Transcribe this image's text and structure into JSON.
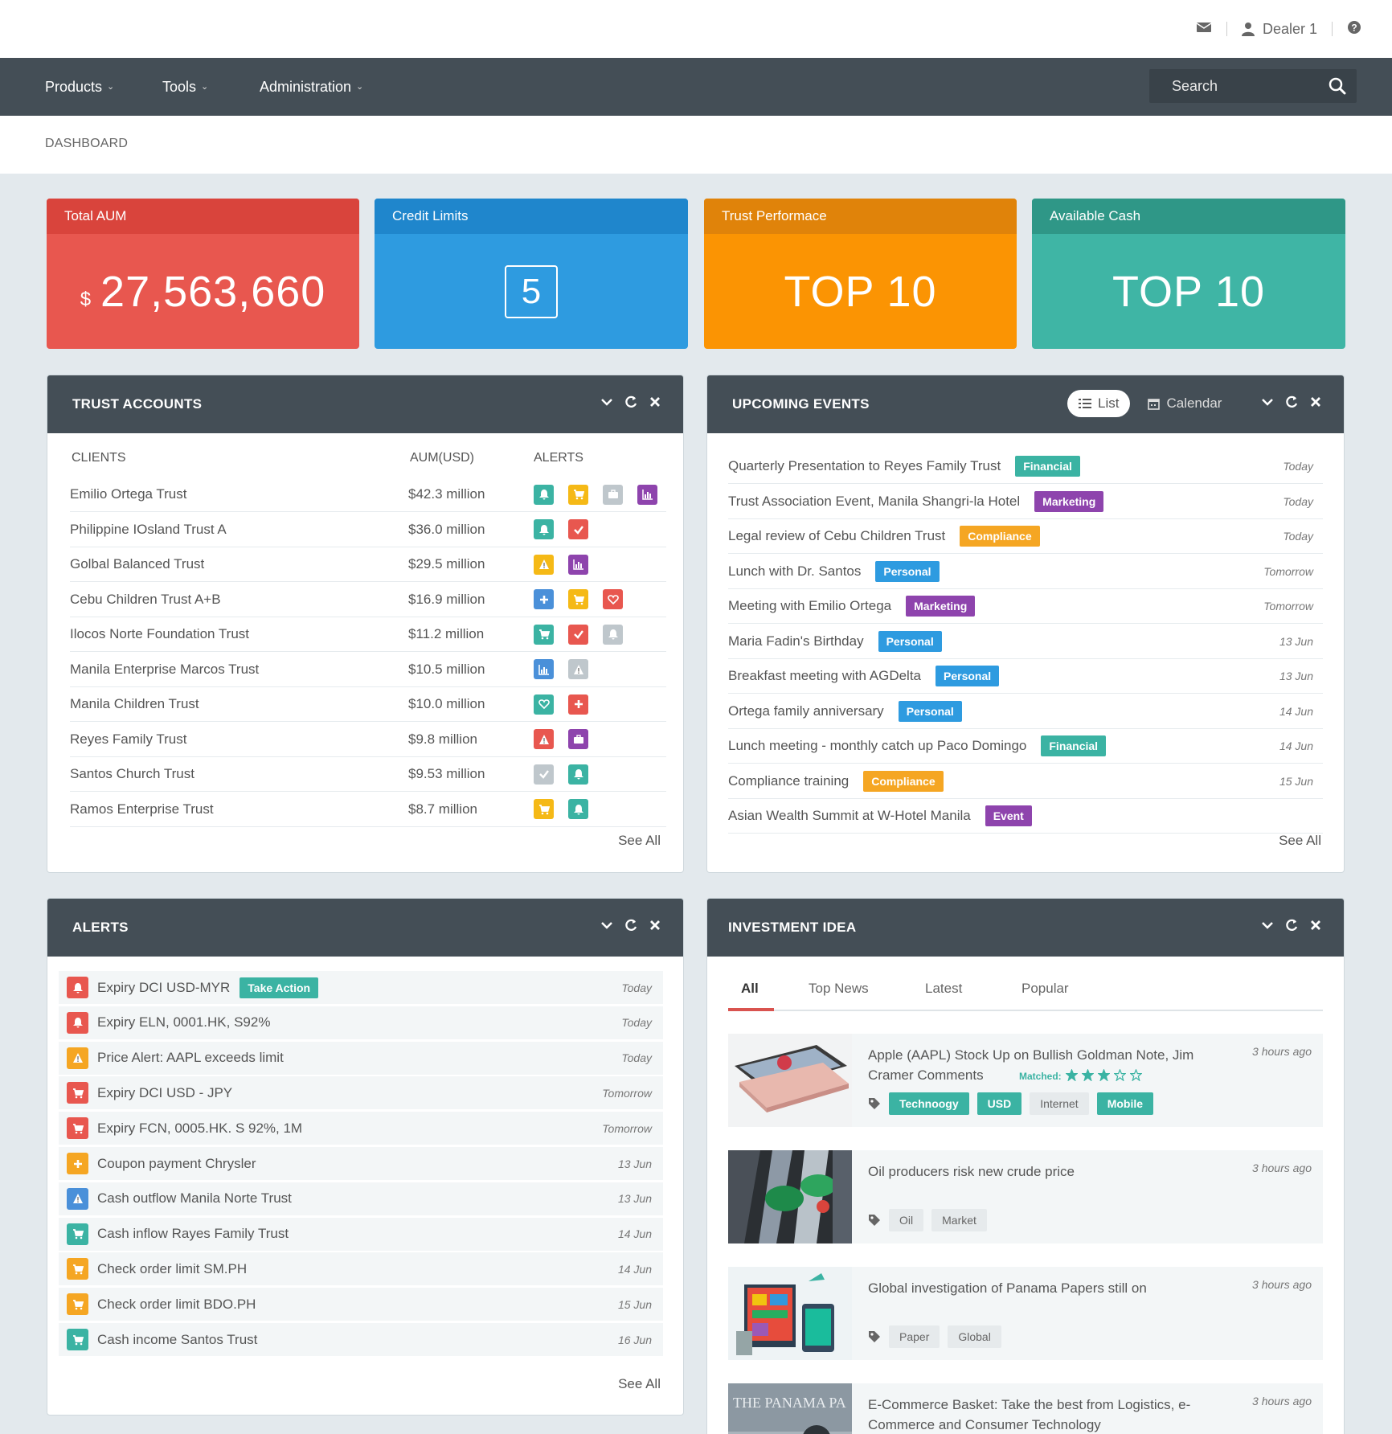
{
  "topbar": {
    "user": "Dealer 1"
  },
  "nav": {
    "products": "Products",
    "tools": "Tools",
    "administration": "Administration",
    "search_placeholder": "Search"
  },
  "breadcrumb": "DASHBOARD",
  "stats": [
    {
      "title": "Total AUM",
      "currency": "$",
      "value": "27,563,660",
      "color": "#e8574f",
      "head_color": "#d9443c"
    },
    {
      "title": "Credit Limits",
      "value": "5",
      "color": "#2e9be0",
      "head_color": "#1f86cc"
    },
    {
      "title": "Trust Performace",
      "value": "TOP 10",
      "color": "#fb9403",
      "head_color": "#e0830a"
    },
    {
      "title": "Available Cash",
      "value": "TOP 10",
      "color": "#3fb5a5",
      "head_color": "#2f9787"
    }
  ],
  "trust_accounts": {
    "title": "TRUST ACCOUNTS",
    "headers": {
      "clients": "CLIENTS",
      "aum": "AUM(USD)",
      "alerts": "ALERTS"
    },
    "rows": [
      {
        "client": "Emilio Ortega Trust",
        "aum": "$42.3 million",
        "alerts": [
          "bell-teal",
          "cart-yellow",
          "briefcase-grey",
          "chart-purple"
        ]
      },
      {
        "client": "Philippine IOsland Trust A",
        "aum": "$36.0 million",
        "alerts": [
          "bell-teal",
          "check-red"
        ]
      },
      {
        "client": "Golbal Balanced Trust",
        "aum": "$29.5 million",
        "alerts": [
          "warning-yellow",
          "chart-purple"
        ]
      },
      {
        "client": "Cebu Children Trust A+B",
        "aum": "$16.9 million",
        "alerts": [
          "plus-blue",
          "cart-yellow",
          "heart-red"
        ]
      },
      {
        "client": "Ilocos Norte Foundation Trust",
        "aum": "$11.2 million",
        "alerts": [
          "cart-teal",
          "check-red",
          "bell-grey"
        ]
      },
      {
        "client": "Manila Enterprise Marcos Trust",
        "aum": "$10.5 million",
        "alerts": [
          "chart-blue",
          "warning-grey"
        ]
      },
      {
        "client": "Manila Children Trust",
        "aum": "$10.0 million",
        "alerts": [
          "heart-teal",
          "plus-red"
        ]
      },
      {
        "client": "Reyes Family Trust",
        "aum": "$9.8 million",
        "alerts": [
          "warning-red",
          "briefcase-purple"
        ]
      },
      {
        "client": "Santos Church Trust",
        "aum": "$9.53 million",
        "alerts": [
          "check-grey",
          "bell-teal"
        ]
      },
      {
        "client": "Ramos Enterprise Trust",
        "aum": "$8.7 million",
        "alerts": [
          "cart-yellow",
          "bell-teal"
        ]
      }
    ],
    "see_all": "See All"
  },
  "events": {
    "title": "UPCOMING EVENTS",
    "list_label": "List",
    "calendar_label": "Calendar",
    "rows": [
      {
        "title": "Quarterly Presentation to Reyes Family Trust",
        "tag": "Financial",
        "when": "Today"
      },
      {
        "title": "Trust Association Event, Manila Shangri-la Hotel",
        "tag": "Marketing",
        "when": "Today"
      },
      {
        "title": "Legal review of Cebu Children Trust",
        "tag": "Compliance",
        "when": "Today"
      },
      {
        "title": "Lunch with Dr. Santos",
        "tag": "Personal",
        "when": "Tomorrow"
      },
      {
        "title": "Meeting with Emilio Ortega",
        "tag": "Marketing",
        "when": "Tomorrow"
      },
      {
        "title": "Maria Fadin's Birthday",
        "tag": "Personal",
        "when": "13 Jun"
      },
      {
        "title": "Breakfast meeting with AGDelta",
        "tag": "Personal",
        "when": "13 Jun"
      },
      {
        "title": "Ortega family anniversary",
        "tag": "Personal",
        "when": "14 Jun"
      },
      {
        "title": "Lunch meeting - monthly catch up Paco Domingo",
        "tag": "Financial",
        "when": "14 Jun"
      },
      {
        "title": "Compliance training",
        "tag": "Compliance",
        "when": "15 Jun"
      },
      {
        "title": "Asian Wealth Summit at W-Hotel Manila",
        "tag": "Event",
        "when": ""
      }
    ],
    "tag_colors": {
      "Financial": "#3bb3a3",
      "Marketing": "#8e44ad",
      "Compliance": "#f5a623",
      "Personal": "#2e9be0",
      "Event": "#8e44ad"
    },
    "see_all": "See All"
  },
  "alerts": {
    "title": "ALERTS",
    "rows": [
      {
        "text": "Expiry DCI USD-MYR",
        "action": "Take Action",
        "icon": "bell-red",
        "when": "Today"
      },
      {
        "text": "Expiry ELN, 0001.HK, S92%",
        "icon": "bell-red",
        "when": "Today"
      },
      {
        "text": "Price Alert: AAPL exceeds limit",
        "icon": "warning-orange",
        "when": "Today"
      },
      {
        "text": "Expiry DCI USD - JPY",
        "icon": "cart-red",
        "when": "Tomorrow"
      },
      {
        "text": "Expiry FCN, 0005.HK. S 92%, 1M",
        "icon": "cart-red",
        "when": "Tomorrow"
      },
      {
        "text": "Coupon payment Chrysler",
        "icon": "plus-orange",
        "when": "13 Jun"
      },
      {
        "text": "Cash outflow Manila Norte Trust",
        "icon": "warning-blue",
        "when": "13 Jun"
      },
      {
        "text": "Cash inflow Rayes Family Trust",
        "icon": "cart-teal",
        "when": "14 Jun"
      },
      {
        "text": "Check order limit SM.PH",
        "icon": "cart-orange",
        "when": "14 Jun"
      },
      {
        "text": "Check order limit BDO.PH",
        "icon": "cart-orange",
        "when": "15 Jun"
      },
      {
        "text": "Cash income Santos Trust",
        "icon": "cart-teal",
        "when": "16 Jun"
      }
    ],
    "see_all": "See All"
  },
  "investment": {
    "title": "INVESTMENT IDEA",
    "tabs": [
      "All",
      "Top News",
      "Latest",
      "Popular"
    ],
    "matched_label": "Matched:",
    "matched_rating": 3,
    "news": [
      {
        "title": "Apple (AAPL) Stock Up on Bullish Goldman Note, Jim Cramer Comments",
        "ago": "3 hours ago",
        "tags": [
          {
            "label": "Technoogy",
            "style": "teal"
          },
          {
            "label": "USD",
            "style": "teal"
          },
          {
            "label": "Internet",
            "style": "grey"
          },
          {
            "label": "Mobile",
            "style": "teal"
          }
        ]
      },
      {
        "title": "Oil producers risk new crude price",
        "ago": "3 hours ago",
        "tags": [
          {
            "label": "Oil",
            "style": "grey"
          },
          {
            "label": "Market",
            "style": "grey"
          }
        ]
      },
      {
        "title": "Global investigation of Panama Papers still on",
        "ago": "3 hours ago",
        "tags": [
          {
            "label": "Paper",
            "style": "grey"
          },
          {
            "label": "Global",
            "style": "grey"
          }
        ]
      },
      {
        "title": "E-Commerce Basket: Take the best from Logistics, e-Commerce and Consumer Technology",
        "ago": "3 hours ago",
        "tags": []
      }
    ],
    "thumb4_caption": "THE PANAMA PA"
  }
}
